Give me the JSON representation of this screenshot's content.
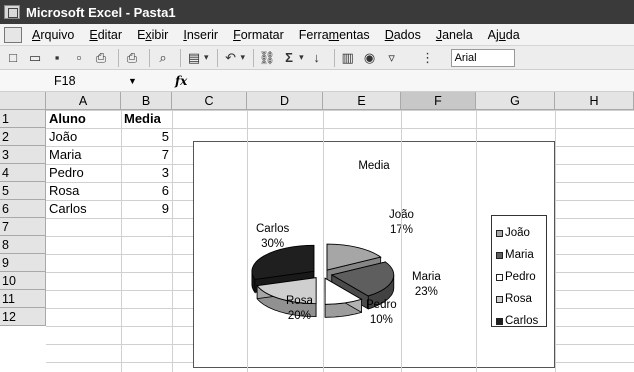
{
  "window": {
    "title": "Microsoft Excel - Pasta1"
  },
  "menu": [
    {
      "pre": "",
      "ul": "A",
      "post": "rquivo"
    },
    {
      "pre": "",
      "ul": "E",
      "post": "ditar"
    },
    {
      "pre": "E",
      "ul": "x",
      "post": "ibir"
    },
    {
      "pre": "",
      "ul": "I",
      "post": "nserir"
    },
    {
      "pre": "",
      "ul": "F",
      "post": "ormatar"
    },
    {
      "pre": "Ferra",
      "ul": "m",
      "post": "entas"
    },
    {
      "pre": "",
      "ul": "D",
      "post": "ados"
    },
    {
      "pre": "",
      "ul": "J",
      "post": "anela"
    },
    {
      "pre": "Aj",
      "ul": "u",
      "post": "da"
    }
  ],
  "toolbar": {
    "font_name": "Arial"
  },
  "formula_bar": {
    "cell_ref": "F18",
    "fx": "fx"
  },
  "columns": [
    "A",
    "B",
    "C",
    "D",
    "E",
    "F",
    "G",
    "H"
  ],
  "selected_column": "F",
  "rows": [
    "1",
    "2",
    "3",
    "4",
    "5",
    "6",
    "7",
    "8",
    "9",
    "10",
    "11",
    "12"
  ],
  "cells": {
    "header": [
      "Aluno",
      "Media"
    ],
    "data": [
      {
        "aluno": "João",
        "media": "5"
      },
      {
        "aluno": "Maria",
        "media": "7"
      },
      {
        "aluno": "Pedro",
        "media": "3"
      },
      {
        "aluno": "Rosa",
        "media": "6"
      },
      {
        "aluno": "Carlos",
        "media": "9"
      }
    ]
  },
  "chart_data": {
    "type": "pie",
    "title": "Media",
    "exploded": true,
    "three_d": true,
    "legend_placement": "right",
    "labels": [
      "João",
      "Maria",
      "Pedro",
      "Rosa",
      "Carlos"
    ],
    "values": [
      5,
      7,
      3,
      6,
      9
    ],
    "percent_labels": [
      "17%",
      "23%",
      "10%",
      "20%",
      "30%"
    ],
    "colors": [
      "#a6a6a6",
      "#5e5e5e",
      "#ffffff",
      "#cfcfcf",
      "#1f1f1f"
    ]
  }
}
